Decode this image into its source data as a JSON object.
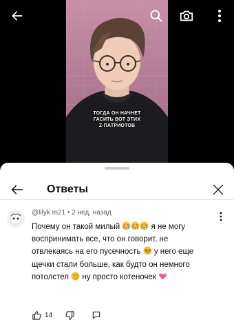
{
  "video": {
    "caption_lines": [
      "ТОГДА ОН НАЧНЕТ",
      "ГАСИТЬ ВОТ ЭТИХ",
      "Z-ПАТРИОТОВ"
    ]
  },
  "topbar": {
    "icons": [
      "back-arrow-icon",
      "search-icon",
      "camera-icon",
      "more-vertical-icon"
    ],
    "icon_color": "#ffffff"
  },
  "sheet": {
    "title": "Ответы"
  },
  "comment": {
    "author": "@lilyk m21",
    "separator": "•",
    "time": "2 нед. назад",
    "text_parts": [
      "Почему он такой милый ",
      " я не могу воспринимать все, что он говорит, не отвлекаясь на его пусечность ",
      " у него еще щечки стали больше, как будто он немного потолстел ",
      " ну просто котеночек "
    ],
    "likes": "14"
  },
  "colors": {
    "text_primary": "#0f0f0f",
    "text_secondary": "#606060",
    "sheet_bg": "#ffffff",
    "video_bg": "#000000"
  }
}
